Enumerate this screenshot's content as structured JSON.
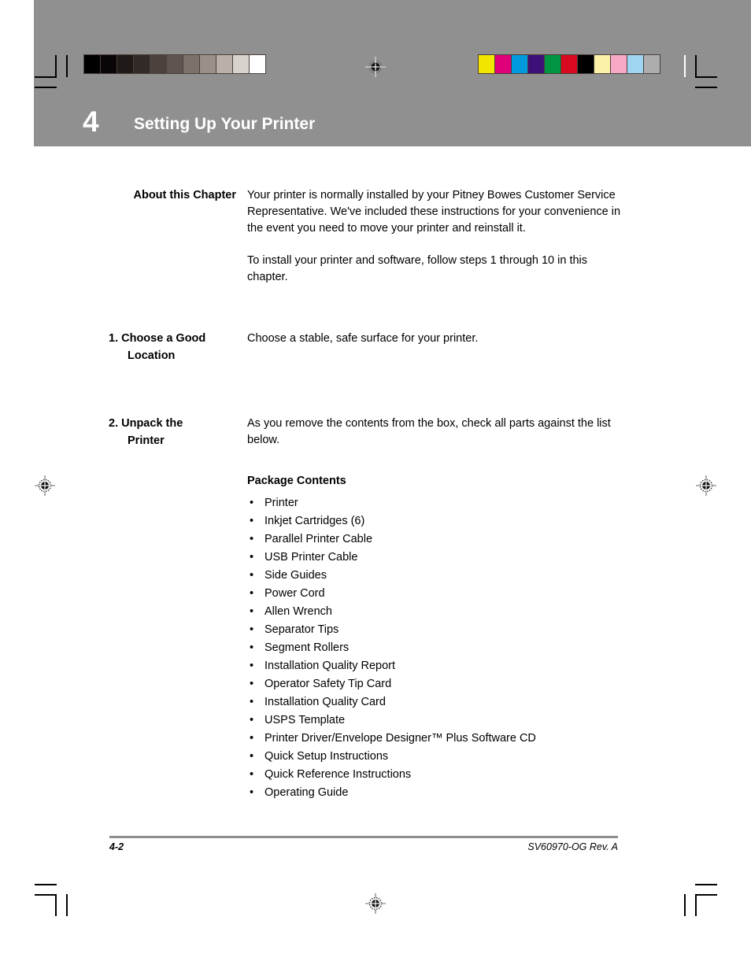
{
  "document": {
    "chapter_number": "4",
    "chapter_title": "Setting Up Your Printer"
  },
  "calibration": {
    "grayscale_swatches": [
      "#000000",
      "#0a0506",
      "#1f1a18",
      "#312a27",
      "#4b423d",
      "#5f544f",
      "#7d716b",
      "#9b8f89",
      "#bab0aa",
      "#d9d3ce",
      "#ffffff"
    ],
    "color_swatches": [
      "#f2e500",
      "#e0007a",
      "#0099de",
      "#3d1078",
      "#009540",
      "#d90a20",
      "#000000",
      "#fbf2a8",
      "#f7a8c4",
      "#9fd5f2",
      "#adadad"
    ],
    "band_color": "#909090"
  },
  "sections": [
    {
      "heading": "About this Chapter",
      "numbered": false,
      "paragraphs": [
        "Your printer is normally installed by your Pitney Bowes Customer Service Representative. We've included these instructions for your convenience in the event you need to move your printer and reinstall it.",
        "To install your printer and software, follow steps 1 through 10 in this chapter."
      ]
    },
    {
      "heading_number": "1.",
      "heading_line1": "Choose a Good",
      "heading_line2": "Location",
      "numbered": true,
      "paragraphs": [
        "Choose a stable, safe surface for your printer."
      ]
    },
    {
      "heading_number": "2.",
      "heading_line1": "Unpack the",
      "heading_line2": "Printer",
      "numbered": true,
      "paragraphs": [
        "As you remove the contents from the box, check all parts against the list below."
      ]
    }
  ],
  "package": {
    "title": "Package Contents",
    "bullet_glyph": "•",
    "items": [
      "Printer",
      "Inkjet Cartridges (6)",
      "Parallel Printer Cable",
      "USB Printer Cable",
      "Side Guides",
      "Power Cord",
      "Allen Wrench",
      "Separator Tips",
      "Segment Rollers",
      "Installation Quality Report",
      "Operator Safety Tip Card",
      "Installation Quality Card",
      "USPS Template",
      "Printer Driver/Envelope Designer™ Plus Software CD",
      "Quick Setup Instructions",
      "Quick Reference Instructions",
      "Operating Guide"
    ]
  },
  "footer": {
    "page_number": "4-2",
    "doc_code": "SV60970-OG Rev. A",
    "rule_color": "#8e8e8e"
  }
}
